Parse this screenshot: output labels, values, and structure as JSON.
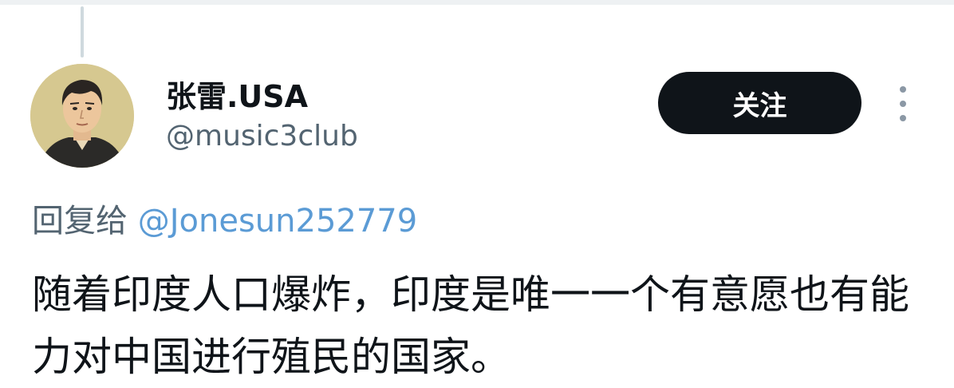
{
  "tweet": {
    "display_name": "张雷.USA",
    "handle": "@music3club",
    "follow_label": "关注",
    "reply_prefix": "回复给",
    "reply_to": "@Jonesun252779",
    "text": "随着印度人口爆炸，印度是唯一一个有意愿也有能力对中国进行殖民的国家。"
  },
  "icons": {
    "more": "more-vertical-icon",
    "avatar": "user-avatar"
  },
  "colors": {
    "text_primary": "#0f1419",
    "text_secondary": "#536471",
    "mention": "#5b9bd5",
    "follow_bg": "#0f1419",
    "follow_text": "#ffffff"
  }
}
